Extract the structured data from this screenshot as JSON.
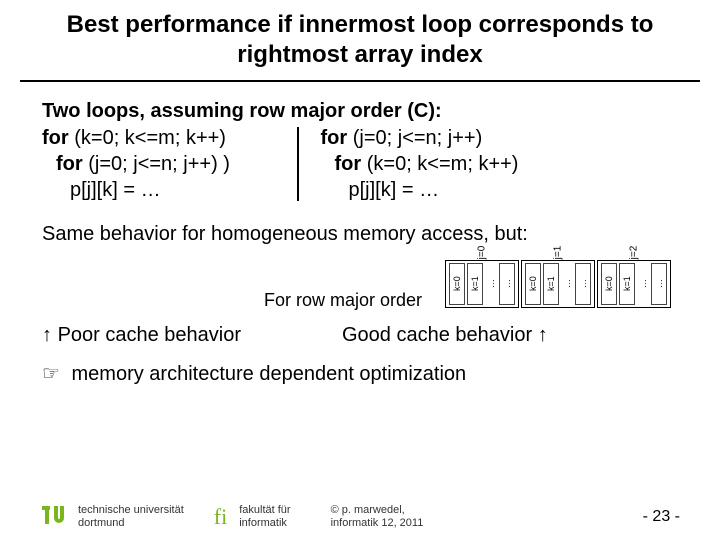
{
  "title_line1": "Best performance if innermost loop corresponds to",
  "title_line2": "rightmost array index",
  "intro": "Two loops, assuming row major order (C):",
  "left": {
    "l1_for": "for",
    "l1_rest": " (k=0; k<=m; k++)",
    "l2_for": "for",
    "l2_rest": " (j=0; j<=n; j++) )",
    "l3": "p[j][k] = …"
  },
  "right": {
    "l1_for": "for",
    "l1_rest": " (j=0; j<=n; j++)",
    "l2_for": "for",
    "l2_rest": " (k=0; k<=m; k++)",
    "l3": "p[j][k] = …"
  },
  "same_behavior": "Same behavior for homogeneous memory access, but:",
  "diagram_caption": "For row major order",
  "diagram": {
    "j_groups": [
      "j=0",
      "j=1",
      "j=2"
    ],
    "k_cells": [
      "k=0",
      "k=1",
      "…",
      "…"
    ]
  },
  "poor": "Poor cache behavior",
  "good": "Good cache behavior",
  "memo_text": "memory architecture dependent optimization",
  "footer": {
    "uni1": "technische universität",
    "uni2": "dortmund",
    "fac1": "fakultät für",
    "fac2": "informatik",
    "copy1": "© p. marwedel,",
    "copy2": "informatik 12, 2011",
    "page": "- 23 -"
  }
}
